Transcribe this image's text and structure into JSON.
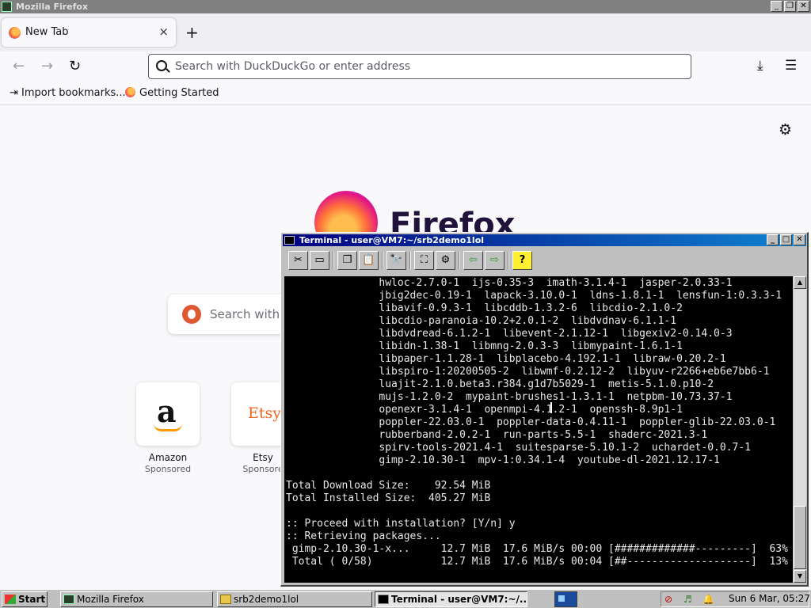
{
  "firefox": {
    "window_title": "Mozilla Firefox",
    "tab_title": "New Tab",
    "tab_close": "×",
    "new_tab": "+",
    "address_placeholder": "Search with DuckDuckGo or enter address",
    "bookmarks": [
      "Import bookmarks...",
      "Getting Started"
    ],
    "logo_word": "Firefox",
    "search_placeholder": "Search with D",
    "shortcuts": [
      {
        "title": "Amazon",
        "subtitle": "Sponsored",
        "logo": "a"
      },
      {
        "title": "Etsy",
        "subtitle": "Sponsore",
        "logo": "Etsy"
      }
    ],
    "icons": [
      "back-icon",
      "forward-icon",
      "reload-icon",
      "search-icon",
      "download-icon",
      "menu-icon",
      "gear-icon"
    ]
  },
  "terminal": {
    "title": "Terminal - user@VM7:~/srb2demo1lol",
    "lines": [
      "               hwloc-2.7.0-1  ijs-0.35-3  imath-3.1.4-1  jasper-2.0.33-1",
      "               jbig2dec-0.19-1  lapack-3.10.0-1  ldns-1.8.1-1  lensfun-1:0.3.3-1",
      "               libavif-0.9.3-1  libcddb-1.3.2-6  libcdio-2.1.0-2",
      "               libcdio-paranoia-10.2+2.0.1-2  libdvdnav-6.1.1-1",
      "               libdvdread-6.1.2-1  libevent-2.1.12-1  libgexiv2-0.14.0-3",
      "               libidn-1.38-1  libmng-2.0.3-3  libmypaint-1.6.1-1",
      "               libpaper-1.1.28-1  libplacebo-4.192.1-1  libraw-0.20.2-1",
      "               libspiro-1:20200505-2  libwmf-0.2.12-2  libyuv-r2266+eb6e7bb6-1",
      "               luajit-2.1.0.beta3.r384.g1d7b5029-1  metis-5.1.0.p10-2",
      "               mujs-1.2.0-2  mypaint-brushes1-1.3.1-1  netpbm-10.73.37-1",
      "               openexr-3.1.4-1  openmpi-4.1.2-1  openssh-8.9p1-1",
      "               poppler-22.03.0-1  poppler-data-0.4.11-1  poppler-glib-22.03.0-1",
      "               rubberband-2.0.2-1  run-parts-5.5-1  shaderc-2021.3-1",
      "               spirv-tools-2021.4-1  suitesparse-5.10.1-2  uchardet-0.0.7-1",
      "               gimp-2.10.30-1  mpv-1:0.34.1-4  youtube-dl-2021.12.17-1",
      "",
      "Total Download Size:    92.54 MiB",
      "Total Installed Size:  405.27 MiB",
      "",
      ":: Proceed with installation? [Y/n] y",
      ":: Retrieving packages...",
      " gimp-2.10.30-1-x...     12.7 MiB  17.6 MiB/s 00:00 [#############---------]  63%",
      " Total ( 0/58)           12.7 MiB  17.6 MiB/s 00:04 [##--------------------]  13%"
    ]
  },
  "taskbar": {
    "start": "Start",
    "items": [
      "Mozilla Firefox",
      "srb2demo1lol",
      "Terminal - user@VM7:~/..."
    ],
    "clock": "Sun 6 Mar, 05:27"
  }
}
